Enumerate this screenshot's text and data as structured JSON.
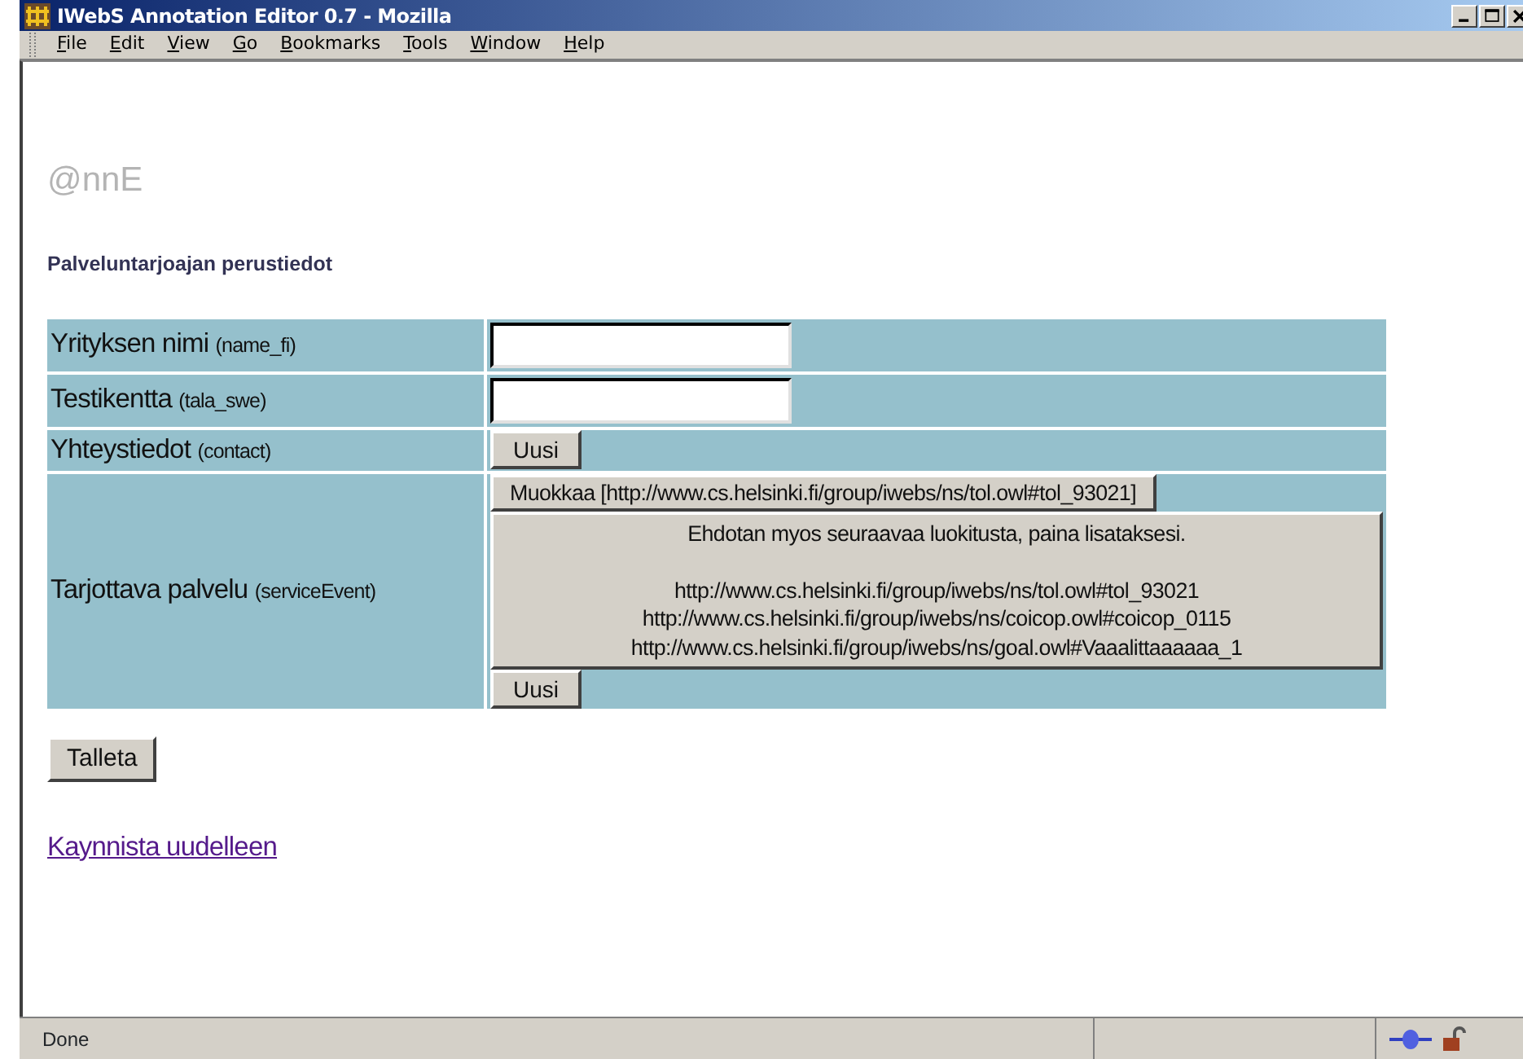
{
  "window": {
    "title": "IWebS Annotation Editor 0.7 - Mozilla"
  },
  "menu": [
    "File",
    "Edit",
    "View",
    "Go",
    "Bookmarks",
    "Tools",
    "Window",
    "Help"
  ],
  "page": {
    "logo": "@nnE",
    "heading": "Palveluntarjoajan perustiedot",
    "rows": [
      {
        "label": "Yrityksen nimi",
        "field_key": "(name_fi)",
        "kind": "input",
        "value": ""
      },
      {
        "label": "Testikentta",
        "field_key": "(tala_swe)",
        "kind": "input",
        "value": ""
      },
      {
        "label": "Yhteystiedot",
        "field_key": "(contact)",
        "kind": "button",
        "button": "Uusi"
      },
      {
        "label": "Tarjottava palvelu",
        "field_key": "(serviceEvent)",
        "kind": "classification",
        "edit_button": "Muokkaa [http://www.cs.helsinki.fi/group/iwebs/ns/tol.owl#tol_93021]",
        "suggestion": {
          "intro": "Ehdotan myos seuraavaa luokitusta, paina lisataksesi.",
          "urls": [
            "http://www.cs.helsinki.fi/group/iwebs/ns/tol.owl#tol_93021",
            "http://www.cs.helsinki.fi/group/iwebs/ns/coicop.owl#coicop_0115",
            "http://www.cs.helsinki.fi/group/iwebs/ns/goal.owl#Vaaalittaaaaaa_1"
          ]
        },
        "button": "Uusi"
      }
    ],
    "save_button": "Talleta",
    "restart_link": "Kaynnista uudelleen"
  },
  "status_bar": {
    "text": "Done"
  }
}
